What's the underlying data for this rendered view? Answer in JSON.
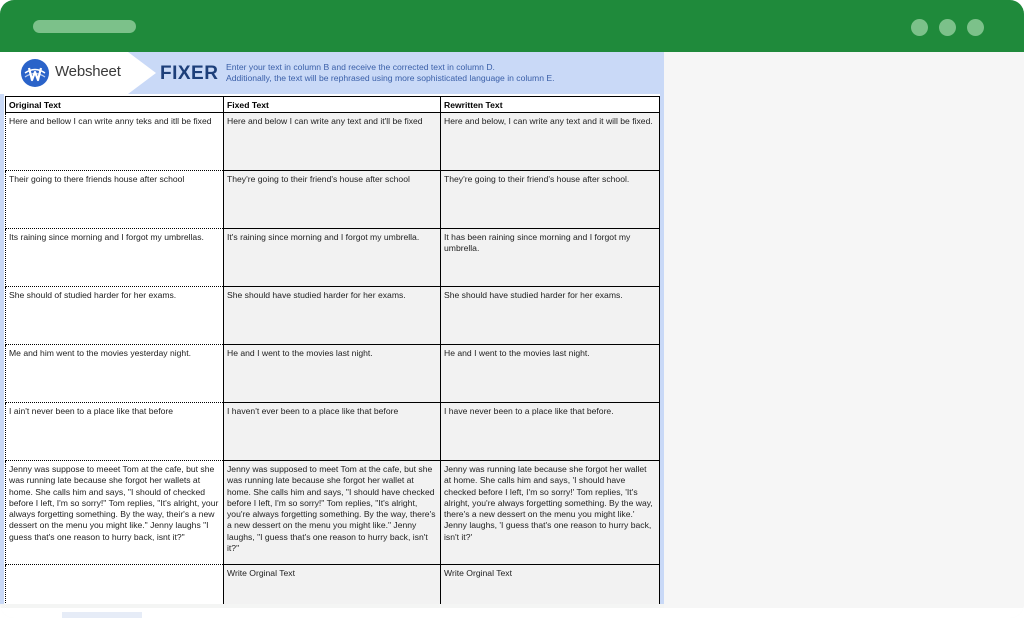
{
  "window": {
    "accent_color": "#1f8a3b",
    "controls": [
      "window-dot",
      "window-dot",
      "window-dot"
    ]
  },
  "banner": {
    "logo_text": "Websheet",
    "title": "FIXER",
    "instruction_line1": "Enter your text in column B and receive the corrected text in column D.",
    "instruction_line2": "Additionally, the text will be rephrased using more sophisticated language in column E."
  },
  "table": {
    "headers": [
      "Original Text",
      "Fixed Text",
      "Rewritten Text"
    ],
    "rows": [
      [
        "Here and bellow I can write anny teks and itll be fixed",
        "Here and below I can write any text and it'll be fixed",
        "Here and below, I can write any text and it will be fixed."
      ],
      [
        "Their going to there friends house after school",
        "They're going to their friend's house after school",
        "They're going to their friend's house after school."
      ],
      [
        "Its raining since morning and I forgot my umbrellas.",
        "It's raining since morning and I forgot my umbrella.",
        "It has been raining since morning and I forgot my umbrella."
      ],
      [
        "She should of studied harder for her exams.",
        "She should have studied harder for her exams.",
        "She should have studied harder for her exams."
      ],
      [
        "Me and him went to the movies yesterday night.",
        "He and I went to the movies last night.",
        "He and I went to the movies last night."
      ],
      [
        "I ain't never been to a place like that before",
        "I haven't ever been to a place like that before",
        "I have never been to a place like that before."
      ],
      [
        "Jenny was suppose to meeet Tom at the cafe, but she was running late because she forgot her wallets at home. She calls him and says, \"I should of checked before I left, I'm so sorry!\" Tom replies, \"It's alright, your always forgetting something. By the way, their's a new dessert on the menu you might like.\" Jenny laughs \"I guess that's one reason to hurry back, isnt it?\"",
        "Jenny was supposed to meet Tom at the cafe, but she was running late because she forgot her wallet at home. She calls him and says, \"I should have checked before I left, I'm so sorry!\" Tom replies, \"It's alright, you're always forgetting something. By the way, there's a new dessert on the menu you might like.\" Jenny laughs, \"I guess that's one reason to hurry back, isn't it?\"",
        "Jenny was running late because she forgot her wallet at home. She calls him and says, 'I should have checked before I left, I'm so sorry!' Tom replies, 'It's alright, you're always forgetting something. By the way, there's a new dessert on the menu you might like.' Jenny laughs, 'I guess that's one reason to hurry back, isn't it?'"
      ],
      [
        "",
        "Write Orginal Text",
        "Write Orginal Text"
      ]
    ]
  }
}
